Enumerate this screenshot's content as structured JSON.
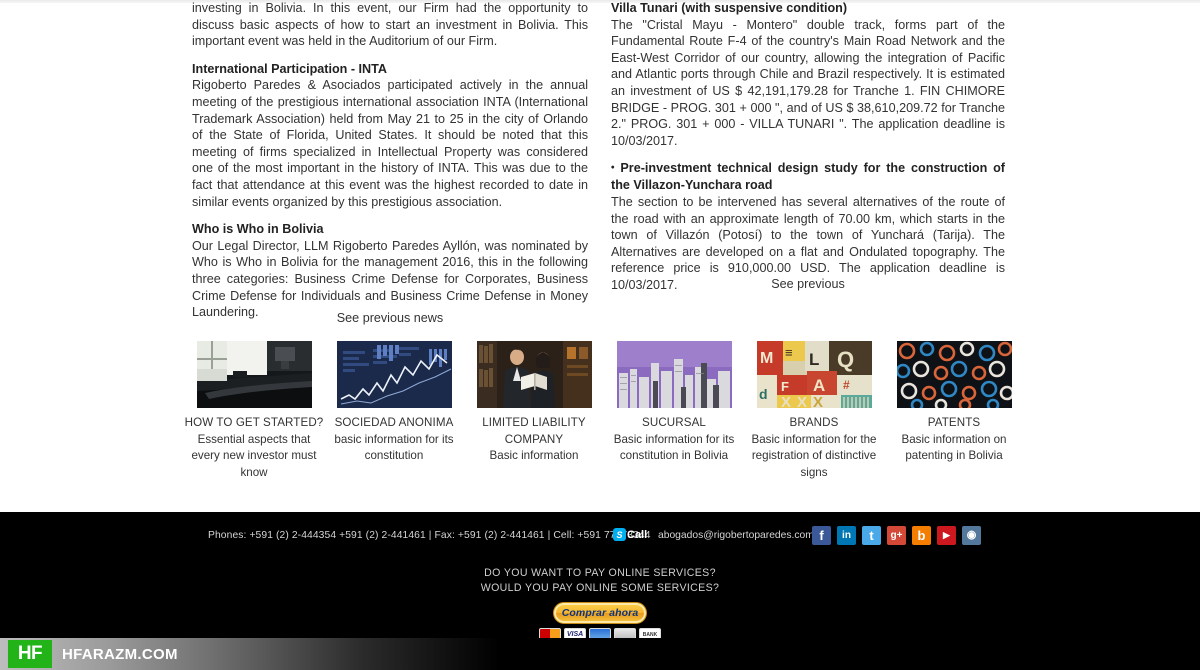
{
  "left_column": {
    "intro_paragraph": "investing in Bolivia. In this event, our Firm had the opportunity to discuss basic aspects of how to start an investment in Bolivia. This important event was held in the Auditorium of our Firm.",
    "heading_inta": "International Participation - INTA",
    "paragraph_inta": "Rigoberto Paredes & Asociados participated actively in the annual meeting of the prestigious international association INTA (International Trademark Association) held from May 21 to 25 in the city of Orlando of the State of Florida, United States. It should be noted that this meeting of firms specialized in Intellectual Property was considered one of the most important in the history of INTA. This was due to the fact that attendance at this event was the highest recorded to date in similar events organized by this prestigious association.",
    "heading_who": "Who is Who in Bolivia",
    "paragraph_who": "Our Legal Director, LLM Rigoberto Paredes Ayllón, was nominated by Who is Who in Bolivia for the management 2016, this in the following three categories: Business Crime Defense for Corporates, Business Crime Defense for Individuals and Business Crime Defense in Money Laundering.",
    "see_previous_news": "See previous news"
  },
  "right_column": {
    "heading_villa_tunari": "Villa Tunari (with suspensive condition)",
    "paragraph_villa_tunari": "The \"Cristal Mayu - Montero\" double track, forms part of the Fundamental Route F-4 of the country's Main Road Network and the East-West Corridor of our country, allowing the integration of Pacific and Atlantic ports through Chile and Brazil respectively. It is estimated an investment of US $ 42,191,179.28 for Tranche 1. FIN CHIMORE BRIDGE - PROG. 301 + 000 \", and of US $ 38,610,209.72 for Tranche 2.\" PROG. 301 + 000 - VILLA TUNARI \". The application deadline is 10/03/2017.",
    "heading_villazon_bullet": "•",
    "heading_villazon": "Pre-investment technical design study for the construction of the Villazon-Yunchara road",
    "paragraph_villazon": "The section to be intervened has several alternatives of the route of the road with an approximate length of 70.00 km, which starts in the town of Villazón (Potosí) to the town of Yunchará (Tarija). The Alternatives are developed on a flat and Ondulated topography. The reference price is 910,000.00 USD. The application deadline is 10/03/2017.",
    "see_previous": "See previous"
  },
  "cards": [
    {
      "title": "HOW TO GET STARTED?",
      "desc": "Essential aspects that every new investor must know",
      "image_name": "office-interior-thumbnail"
    },
    {
      "title": "SOCIEDAD ANONIMA",
      "desc": "basic information for its constitution",
      "image_name": "stock-chart-thumbnail"
    },
    {
      "title": "LIMITED LIABILITY COMPANY",
      "desc": "Basic information",
      "image_name": "business-people-thumbnail"
    },
    {
      "title": "SUCURSAL",
      "desc": "Basic information for its constitution in Bolivia",
      "image_name": "city-skyline-thumbnail"
    },
    {
      "title": "BRANDS",
      "desc": "Basic information for the registration of distinctive signs",
      "image_name": "typography-collage-thumbnail"
    },
    {
      "title": "PATENTS",
      "desc": "Basic information on patenting in Bolivia",
      "image_name": "abstract-circles-thumbnail"
    }
  ],
  "footer": {
    "phones": "Phones: +591 (2) 2-444354 +591 (2) 2-441461 | Fax: +591 (2) 2-441461 | Cell: +591 77773344",
    "skype_badge": "S",
    "skype_label": "Call",
    "email": "abogados@rigobertoparedes.com",
    "socials": [
      {
        "name": "facebook-icon",
        "glyph": "f",
        "color": "#3b5998"
      },
      {
        "name": "linkedin-icon",
        "glyph": "in",
        "color": "#0077b5"
      },
      {
        "name": "twitter-icon",
        "glyph": "t",
        "color": "#4aa9e8"
      },
      {
        "name": "google-plus-icon",
        "glyph": "g+",
        "color": "#d34836"
      },
      {
        "name": "blogger-icon",
        "glyph": "b",
        "color": "#f57d00"
      },
      {
        "name": "youtube-icon",
        "glyph": "▶",
        "color": "#cc181e"
      },
      {
        "name": "instagram-icon",
        "glyph": "◉",
        "color": "#54789b"
      }
    ],
    "pay_question_1": "DO YOU WANT TO PAY ONLINE SERVICES?",
    "pay_question_2": "WOULD YOU PAY ONLINE SOME SERVICES?",
    "buy_button": "Comprar ahora",
    "payment_cards": [
      {
        "name": "mastercard-logo",
        "label": ""
      },
      {
        "name": "visa-logo",
        "label": "VISA"
      },
      {
        "name": "maestro-logo",
        "label": ""
      },
      {
        "name": "amex-logo",
        "label": ""
      },
      {
        "name": "bank-logo",
        "label": "BANK"
      }
    ]
  },
  "watermark": {
    "logo_text": "HF",
    "site_text": "HFARAZM.COM",
    "logo_color": "#22b319"
  }
}
